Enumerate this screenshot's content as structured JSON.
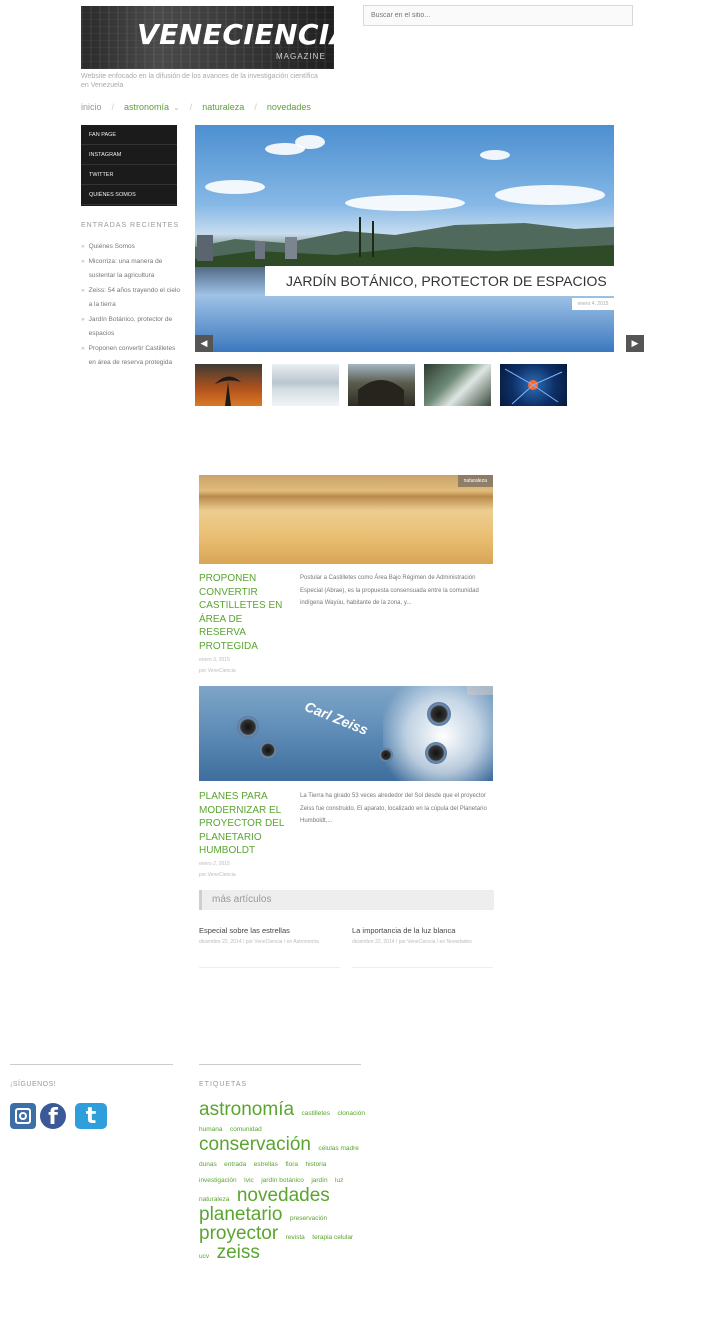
{
  "header": {
    "logo_text": "VENECIENCIA",
    "logo_sub": "MAGAZINE",
    "tagline": "Website enfocado en la difusión de los avances de la investigación científica en Venezuela",
    "search_placeholder": "Buscar en el sitio..."
  },
  "nav": {
    "items": [
      "inicio",
      "astronomía",
      "naturaleza",
      "novedades"
    ],
    "dropdown_icon": "chevron-down"
  },
  "sidebar": {
    "menu": [
      "FAN PAGE",
      "INSTAGRAM",
      "TWITTER",
      "QUIÉNES SOMOS"
    ],
    "recent_heading": "ENTRADAS RECIENTES",
    "recent": [
      "Quiénes Somos",
      "Micorriza: una manera de sustentar la agricultura",
      "Zeiss: 54 años trayendo el cielo a la tierra",
      "Jardín Botánico, protector de espacios",
      "Proponen convertir Castilletes en área de reserva protegida"
    ]
  },
  "slider": {
    "caption": "JARDÍN BOTÁNICO, PROTECTOR DE ESPACIOS",
    "date": "enero 4, 2015",
    "prev_icon": "arrow-left",
    "next_icon": "arrow-right"
  },
  "articles": [
    {
      "category": "naturaleza",
      "title": "PROPONEN CONVERTIR CASTILLETES EN ÁREA DE RESERVA PROTEGIDA",
      "date": "enero 3, 2015",
      "author": "por VeneCiencia",
      "excerpt": "Postular a Castilletes como Área Bajo Régimen de Administración Especial (Abrae), es la propuesta consensuada entre la comunidad indígena Wayúu, habitante de la zona, y..."
    },
    {
      "category": "",
      "image_label": "Carl Zeiss",
      "title": "PLANES PARA MODERNIZAR EL PROYECTOR DEL PLANETARIO HUMBOLDT",
      "date": "enero 2, 2015",
      "author": "por VeneCiencia",
      "excerpt": "La Tierra ha girado 53 veces alrededor del Sol desde que el proyector Zeiss fue construido. El aparato, localizado en la cúpula del Planetario Humboldt,..."
    }
  ],
  "more": {
    "heading": "más artículos",
    "items": [
      {
        "title": "Especial sobre las estrellas",
        "meta": "diciembre 22, 2014 / por VeneCiencia / en Astronomía"
      },
      {
        "title": "La importancia de la luz blanca",
        "meta": "diciembre 22, 2014 / por VeneCiencia / en Novedades"
      }
    ]
  },
  "footer": {
    "follow_heading": "¡SÍGUENOS!",
    "social_icons": [
      "instagram-icon",
      "facebook-icon",
      "twitter-icon"
    ],
    "facebook_glyph": "f",
    "twitter_glyph": "t",
    "tags_heading": "ETIQUETAS",
    "tags": [
      {
        "t": "astronomía",
        "w": 5
      },
      {
        "t": "castilletes",
        "w": 1
      },
      {
        "t": "clonación humana",
        "w": 1
      },
      {
        "t": "comunidad",
        "w": 1
      },
      {
        "t": "conservación",
        "w": 5
      },
      {
        "t": "células madre",
        "w": 1
      },
      {
        "t": "dunas",
        "w": 1
      },
      {
        "t": "entrada",
        "w": 1
      },
      {
        "t": "estrellas",
        "w": 1
      },
      {
        "t": "flora",
        "w": 1
      },
      {
        "t": "historia",
        "w": 1
      },
      {
        "t": "investigación",
        "w": 1
      },
      {
        "t": "Ivic",
        "w": 1
      },
      {
        "t": "jardín botánico",
        "w": 1
      },
      {
        "t": "jardín",
        "w": 1
      },
      {
        "t": "luz",
        "w": 1
      },
      {
        "t": "naturaleza",
        "w": 1
      },
      {
        "t": "novedades",
        "w": 5
      },
      {
        "t": "planetario",
        "w": 5
      },
      {
        "t": "preservación",
        "w": 1
      },
      {
        "t": "proyector",
        "w": 5
      },
      {
        "t": "revista",
        "w": 1
      },
      {
        "t": "terapia celular",
        "w": 1
      },
      {
        "t": "ucv",
        "w": 1
      },
      {
        "t": "zeiss",
        "w": 5
      }
    ]
  },
  "colors": {
    "accent_green": "#5aa52f",
    "nav_dark": "#1b1b1b"
  }
}
